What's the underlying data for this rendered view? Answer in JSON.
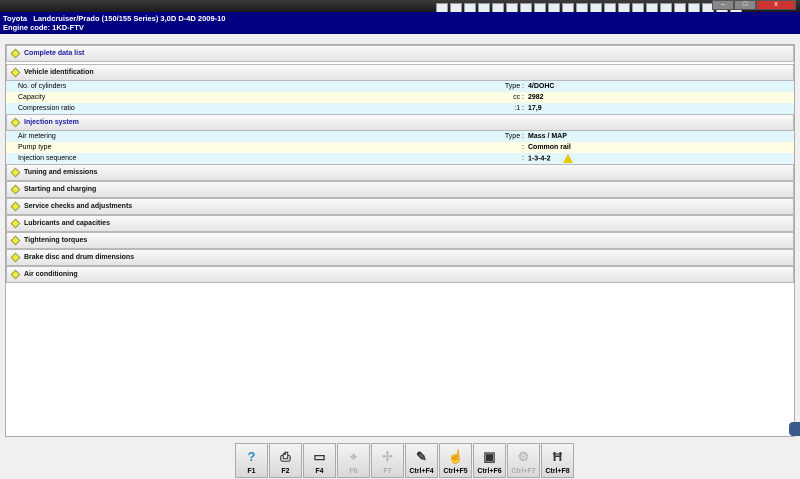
{
  "header": {
    "line1": "Toyota   Landcruiser/Prado (150/155 Series) 3,0D D-4D 2009-10",
    "line2": "Engine code: 1KD-FTV"
  },
  "toolbar_icons": [
    "first-icon",
    "back-icon",
    "warning-icon",
    "diagram-icon",
    "image-icon",
    "gear-icon",
    "timing-icon",
    "wheel-icon",
    "tools-icon",
    "chart-icon",
    "grid-icon",
    "expand-icon",
    "chevron-down-icon",
    "engine-icon",
    "battery-icon",
    "car-icon",
    "service-icon",
    "fuel-icon",
    "light-icon",
    "triangle-icon",
    "vehicle-icon",
    "info-icon"
  ],
  "complete_label": "Complete data list",
  "vehicle": {
    "title": "Vehicle identification",
    "rows": [
      {
        "label": "No. of cylinders",
        "unit": "Type :",
        "value": "4/DOHC"
      },
      {
        "label": "Capacity",
        "unit": "cc :",
        "value": "2982"
      },
      {
        "label": "Compression ratio",
        "unit": ":1 :",
        "value": "17,9"
      }
    ]
  },
  "injection": {
    "title": "Injection system",
    "rows": [
      {
        "label": "Air metering",
        "unit": "Type :",
        "value": "Mass / MAP"
      },
      {
        "label": "Pump type",
        "unit": ":",
        "value": "Common rail"
      },
      {
        "label": "Injection sequence",
        "unit": ":",
        "value": "1-3-4-2"
      }
    ]
  },
  "sections": [
    "Tuning and emissions",
    "Starting and charging",
    "Service checks and adjustments",
    "Lubricants and capacities",
    "Tightening torques",
    "Brake disc and drum dimensions",
    "Air conditioning"
  ],
  "fkeys": [
    {
      "label": "F1",
      "icon": "?",
      "name": "help"
    },
    {
      "label": "F2",
      "icon": "⎙",
      "name": "print"
    },
    {
      "label": "F4",
      "icon": "▭",
      "name": "screen"
    },
    {
      "label": "F6",
      "icon": "⌖",
      "name": "object",
      "disabled": true
    },
    {
      "label": "F7",
      "icon": "✢",
      "name": "measure",
      "disabled": true
    },
    {
      "label": "Ctrl+F4",
      "icon": "✎",
      "name": "notes"
    },
    {
      "label": "Ctrl+F5",
      "icon": "☝",
      "name": "select"
    },
    {
      "label": "Ctrl+F6",
      "icon": "▣",
      "name": "red-chart"
    },
    {
      "label": "Ctrl+F7",
      "icon": "⚙",
      "name": "settings",
      "disabled": true
    },
    {
      "label": "Ctrl+F8",
      "icon": "Ħ",
      "name": "lift"
    }
  ]
}
